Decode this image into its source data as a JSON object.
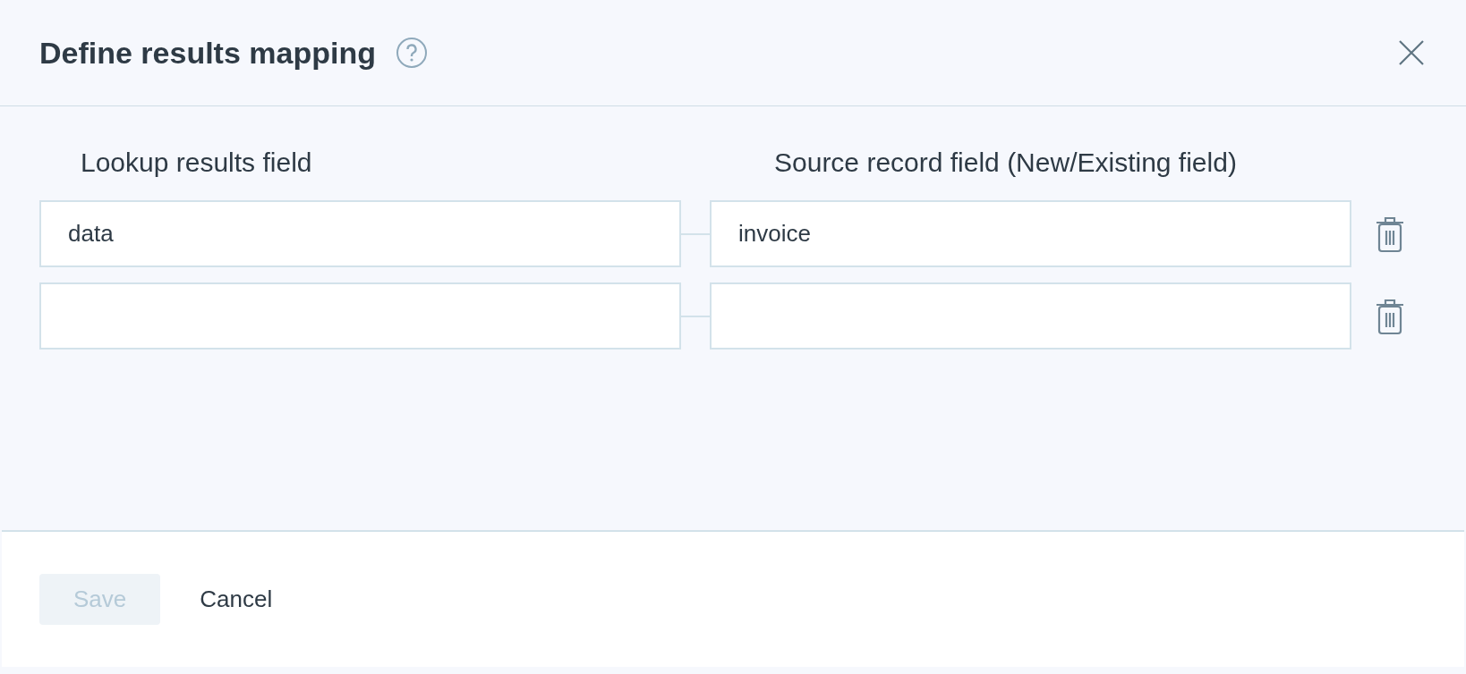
{
  "dialog": {
    "title": "Define results mapping"
  },
  "columns": [
    "Lookup results field",
    "Source record field (New/Existing field)"
  ],
  "rows": [
    {
      "lookup_value": "data",
      "source_value": "invoice"
    },
    {
      "lookup_value": "",
      "source_value": ""
    }
  ],
  "buttons": [
    {
      "label": "Save",
      "kind": "primary",
      "disabled": true
    },
    {
      "label": "Cancel",
      "kind": "link",
      "disabled": false
    }
  ]
}
